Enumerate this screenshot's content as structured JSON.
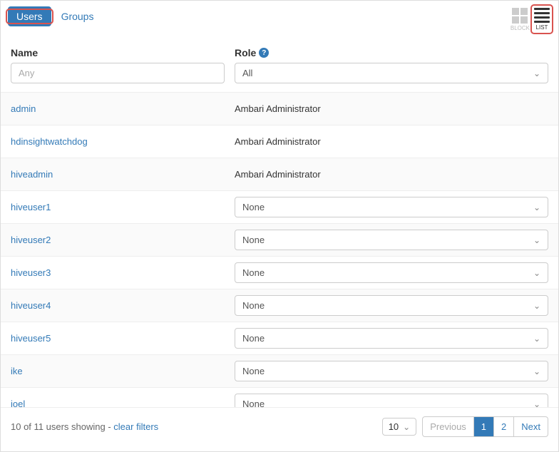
{
  "tabs": {
    "users": "Users",
    "groups": "Groups"
  },
  "view": {
    "block": "BLOCK",
    "list": "LIST"
  },
  "columns": {
    "name": "Name",
    "role": "Role"
  },
  "filters": {
    "name_placeholder": "Any",
    "role_selected": "All"
  },
  "rows": [
    {
      "name": "admin",
      "role_text": "Ambari Administrator",
      "editable": false
    },
    {
      "name": "hdinsightwatchdog",
      "role_text": "Ambari Administrator",
      "editable": false
    },
    {
      "name": "hiveadmin",
      "role_text": "Ambari Administrator",
      "editable": false
    },
    {
      "name": "hiveuser1",
      "role_text": "None",
      "editable": true
    },
    {
      "name": "hiveuser2",
      "role_text": "None",
      "editable": true
    },
    {
      "name": "hiveuser3",
      "role_text": "None",
      "editable": true
    },
    {
      "name": "hiveuser4",
      "role_text": "None",
      "editable": true
    },
    {
      "name": "hiveuser5",
      "role_text": "None",
      "editable": true
    },
    {
      "name": "ike",
      "role_text": "None",
      "editable": true
    },
    {
      "name": "joel",
      "role_text": "None",
      "editable": true
    }
  ],
  "footer": {
    "status": "10 of 11 users showing - ",
    "clear": "clear filters",
    "page_size": "10",
    "prev": "Previous",
    "pages": [
      "1",
      "2"
    ],
    "active_page": "1",
    "next": "Next"
  }
}
